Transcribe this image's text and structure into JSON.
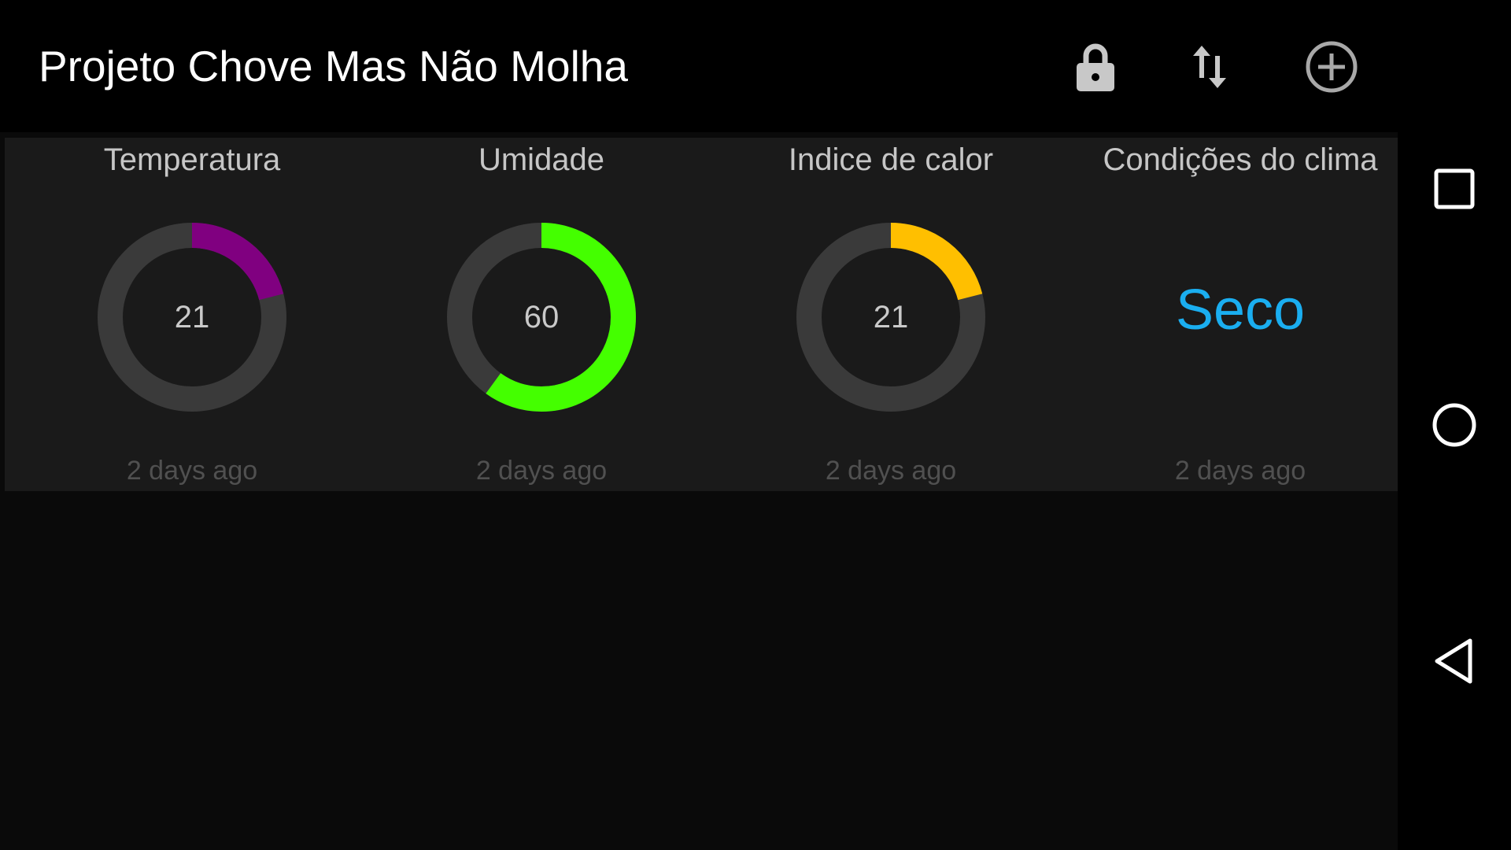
{
  "appbar": {
    "title": "Projeto Chove Mas Não Molha",
    "actions": [
      {
        "icon": "lock-icon"
      },
      {
        "icon": "sort-icon"
      },
      {
        "icon": "add-circle-icon"
      }
    ]
  },
  "widgets": [
    {
      "title": "Temperatura",
      "value": "21",
      "fraction": 0.21,
      "color": "#800080",
      "updated": "2 days ago"
    },
    {
      "title": "Umidade",
      "value": "60",
      "fraction": 0.6,
      "color": "#44ff00",
      "updated": "2 days ago"
    },
    {
      "title": "Indice de calor",
      "value": "21",
      "fraction": 0.21,
      "color": "#ffbf00",
      "updated": "2 days ago"
    },
    {
      "title": "Condições do clima",
      "condition": "Seco",
      "color": "#1aaef0",
      "updated": "2 days ago"
    }
  ],
  "gauge_track_color": "#3a3a3a",
  "navbar": {
    "buttons": [
      {
        "icon": "recents-square-icon"
      },
      {
        "icon": "home-circle-icon"
      },
      {
        "icon": "back-triangle-icon"
      }
    ]
  }
}
